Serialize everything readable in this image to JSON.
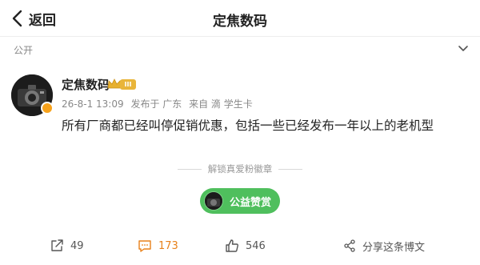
{
  "navbar": {
    "back_label": "返回",
    "title": "定焦数码"
  },
  "visibility": {
    "label": "公开"
  },
  "post": {
    "author": "定焦数码",
    "level_badge": "III",
    "date": "26-8-1 13:09",
    "published_from": "发布于 广东",
    "source": "来自 滴 学生卡",
    "text": "所有厂商都已经叫停促销优惠，包括一些已经发布一年以上的老机型"
  },
  "unlock": {
    "text": "解锁真爱粉徽章"
  },
  "tip": {
    "label": "公益赞赏"
  },
  "actions": {
    "repost_count": "49",
    "comment_count": "173",
    "like_count": "546",
    "share_label": "分享这条博文"
  },
  "colors": {
    "tip_green": "#4fbf5d",
    "comment_orange": "#e8811a",
    "verified_orange": "#f7a21b"
  }
}
